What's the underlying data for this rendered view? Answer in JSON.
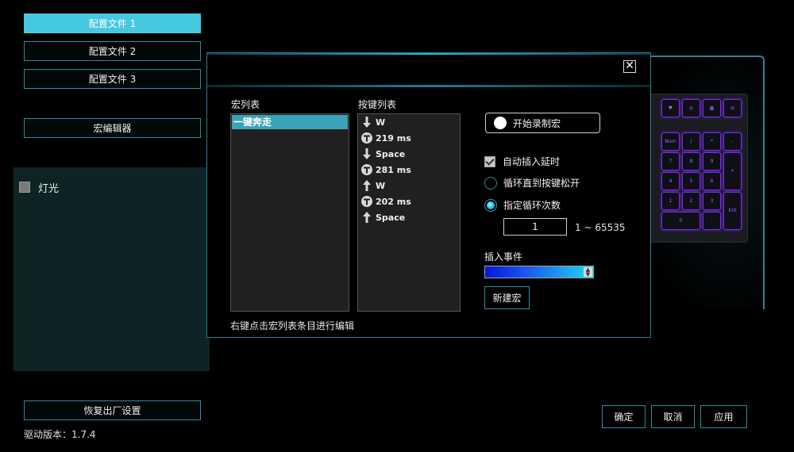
{
  "sidebar": {
    "profiles": [
      "配置文件 1",
      "配置文件 2",
      "配置文件 3"
    ],
    "macro_editor": "宏编辑器",
    "lighting_label": "灯光",
    "factory_reset": "恢复出厂设置",
    "driver_version": "驱动版本：1.7.4"
  },
  "dialog": {
    "macro_list_title": "宏列表",
    "macros": [
      "一键奔走"
    ],
    "key_list_title": "按键列表",
    "keys": [
      {
        "icon": "arrow-down-icon",
        "label": "W"
      },
      {
        "icon": "timer-icon",
        "label": "219 ms"
      },
      {
        "icon": "arrow-down-icon",
        "label": "Space"
      },
      {
        "icon": "timer-icon",
        "label": "281 ms"
      },
      {
        "icon": "arrow-up-icon",
        "label": "W"
      },
      {
        "icon": "timer-icon",
        "label": "202 ms"
      },
      {
        "icon": "arrow-up-icon",
        "label": "Space"
      }
    ],
    "record_button": "开始录制宏",
    "auto_delay": "自动插入延时",
    "loop_until_release": "循环直到按键松开",
    "loop_count_label": "指定循环次数",
    "loop_count_value": "1",
    "loop_range": "1 ~ 65535",
    "insert_event_label": "插入事件",
    "new_macro": "新建宏",
    "hint": "右键点击宏列表条目进行编辑",
    "close_symbol": "✕"
  },
  "footer": {
    "ok": "确定",
    "cancel": "取消",
    "apply": "应用"
  },
  "colors": {
    "accent": "#46c9df",
    "border": "#2a8fa0",
    "key_glow": "#7a2be8"
  }
}
